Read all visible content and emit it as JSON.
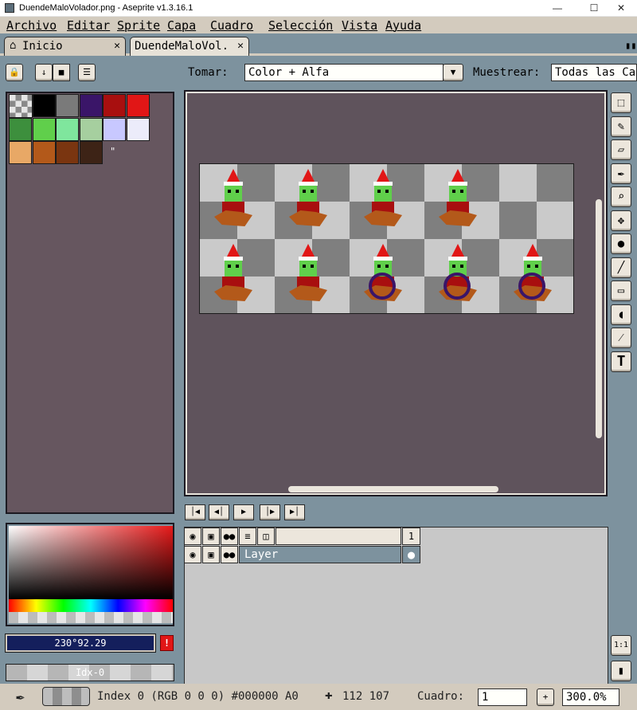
{
  "window": {
    "title": "DuendeMaloVolador.png - Aseprite v1.3.16.1",
    "minimize_icon": "minimize-icon",
    "maximize_icon": "maximize-icon",
    "close_icon": "close-icon"
  },
  "menu": [
    "Archivo",
    "Editar",
    "Sprite",
    "Capa",
    "Cuadro",
    "Selección",
    "Vista",
    "Ayuda"
  ],
  "tabs": [
    {
      "label": "Inicio",
      "icon": "home-icon",
      "active": false
    },
    {
      "label": "DuendeMaloVol.",
      "active": true
    }
  ],
  "toolbar": {
    "take_label": "Tomar:",
    "take_value": "Color + Alfa",
    "sample_label": "Muestrear:",
    "sample_value": "Todas las Ca"
  },
  "palette": {
    "colors": [
      "#000000",
      "#7a7a7a",
      "#3a1568",
      "#a80f0f",
      "#e11616",
      "#3d8f3d",
      "#60cf4b",
      "#7fe69d",
      "#a6cf9f",
      "#c8c8ff",
      "#ececfa",
      "#e8a866",
      "#b3591a",
      "#7a3510",
      "#3d2316"
    ],
    "mark": "\""
  },
  "color_bar": {
    "fg_value": "230°92.29",
    "index_label": "Idx-0",
    "warning_icon": "warning-icon"
  },
  "tools": [
    "marquee-icon",
    "pencil-icon",
    "eraser-icon",
    "eyedropper-icon",
    "zoom-icon",
    "move-icon",
    "fill-icon",
    "line-icon",
    "rectangle-icon",
    "contour-icon",
    "blur-icon",
    "text-icon"
  ],
  "tools_text": {
    "text_tool": "T"
  },
  "timeline": {
    "frame_number": "1",
    "layer_name": "Layer",
    "controls": [
      "first-frame-icon",
      "previous-frame-icon",
      "play-icon",
      "next-frame-icon",
      "last-frame-icon"
    ],
    "side_buttons": {
      "one_to_one": "1:1"
    }
  },
  "status": {
    "index_text": "Index 0 (RGB 0 0 0) #000000 A0",
    "coords": "112 107",
    "frame_label": "Cuadro:",
    "frame_value": "1",
    "zoom_value": "300.0%",
    "plus_label": "+"
  },
  "colors": {
    "workspace": "#7d929e",
    "menubar": "#d3cbbe",
    "panel": "#66565f",
    "canvas": "#5f535c",
    "fg_color_box": "#141f5c"
  }
}
